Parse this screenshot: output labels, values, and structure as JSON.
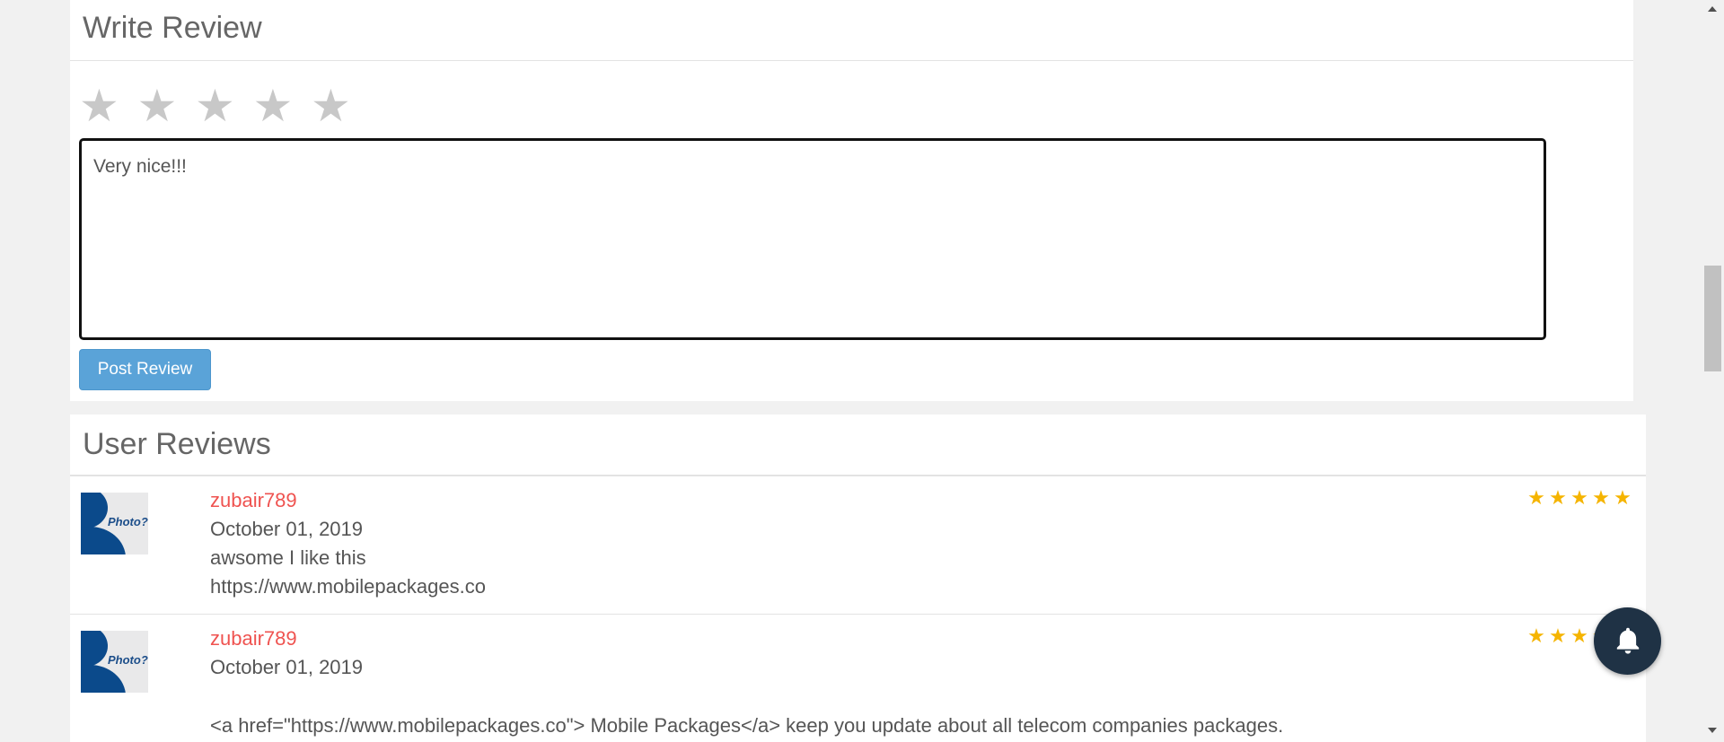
{
  "write_review": {
    "title": "Write Review",
    "stars": [
      "★",
      "★",
      "★",
      "★",
      "★"
    ],
    "rating_value": 0,
    "textarea_value": "Very nice!!!",
    "post_button_label": "Post Review"
  },
  "user_reviews": {
    "title": "User Reviews",
    "avatar_text": "Photo?",
    "items": [
      {
        "username": "zubair789",
        "date": "October 01, 2019",
        "line1": "awsome I like this",
        "line2": "https://www.mobilepackages.co",
        "rating": 5,
        "stars": [
          "★",
          "★",
          "★",
          "★",
          "★"
        ]
      },
      {
        "username": "zubair789",
        "date": "October 01, 2019",
        "line1": "",
        "line2": "<a href=\"https://www.mobilepackages.co\"> Mobile Packages</a> keep you update about all telecom companies packages.",
        "rating": 5,
        "stars": [
          "★",
          "★",
          "★",
          "★",
          "★"
        ]
      }
    ]
  },
  "colors": {
    "accent_button": "#5aa3d8",
    "username_link": "#ef5350",
    "star_filled": "#f5b400",
    "star_empty": "#c8c8c8",
    "bell_background": "#1f3245"
  },
  "icons": {
    "notification": "bell-icon",
    "rating": "star-icon"
  }
}
